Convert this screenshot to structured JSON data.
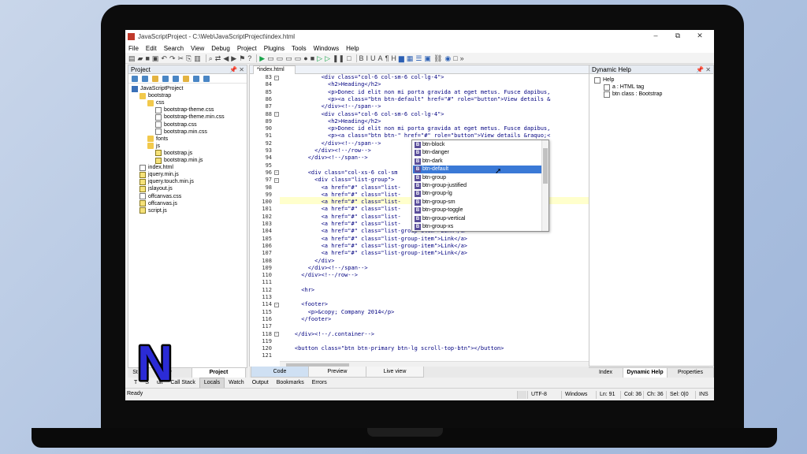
{
  "window": {
    "title": "JavaScriptProject - C:\\Web\\JavaScriptProject\\index.html",
    "controls": [
      "–",
      "⧉",
      "✕"
    ]
  },
  "menu": [
    "File",
    "Edit",
    "Search",
    "View",
    "Debug",
    "Project",
    "Plugins",
    "Tools",
    "Windows",
    "Help"
  ],
  "toolbar": [
    "B",
    "I",
    "U",
    "A",
    "¶",
    "H"
  ],
  "project_panel": {
    "title": "Project",
    "tree": [
      {
        "label": "JavaScriptProject",
        "icon": "project-icon",
        "depth": 0
      },
      {
        "label": "bootstrap",
        "icon": "folder-icon",
        "depth": 1
      },
      {
        "label": "css",
        "icon": "folder-icon",
        "depth": 2
      },
      {
        "label": "bootstrap-theme.css",
        "icon": "file-icon",
        "depth": 3
      },
      {
        "label": "bootstrap-theme.min.css",
        "icon": "file-icon",
        "depth": 3
      },
      {
        "label": "bootstrap.css",
        "icon": "file-icon",
        "depth": 3
      },
      {
        "label": "bootstrap.min.css",
        "icon": "file-icon",
        "depth": 3
      },
      {
        "label": "fonts",
        "icon": "folder-icon",
        "depth": 2
      },
      {
        "label": "js",
        "icon": "folder-icon",
        "depth": 2
      },
      {
        "label": "bootstrap.js",
        "icon": "js-file-icon",
        "depth": 3
      },
      {
        "label": "bootstrap.min.js",
        "icon": "js-file-icon",
        "depth": 3
      },
      {
        "label": "index.html",
        "icon": "file-icon",
        "depth": 1
      },
      {
        "label": "jquery.min.js",
        "icon": "js-file-icon",
        "depth": 1
      },
      {
        "label": "jquery.touch.min.js",
        "icon": "js-file-icon",
        "depth": 1
      },
      {
        "label": "jslayout.js",
        "icon": "js-file-icon",
        "depth": 1
      },
      {
        "label": "offcanvas.css",
        "icon": "file-icon",
        "depth": 1
      },
      {
        "label": "offcanvas.js",
        "icon": "js-file-icon",
        "depth": 1
      },
      {
        "label": "script.js",
        "icon": "js-file-icon",
        "depth": 1
      }
    ],
    "tabs": [
      "St",
      "iew",
      "Project"
    ]
  },
  "editor": {
    "tab_label": "*index.html",
    "lines": [
      {
        "n": "83",
        "code": "            <div class=\"col-6 col-sm-6 col-lg-4\">"
      },
      {
        "n": "84",
        "code": "              <h2>Heading</h2>"
      },
      {
        "n": "85",
        "code": "              <p>Donec id elit non mi porta gravida at eget metus. Fusce dapibus,"
      },
      {
        "n": "86",
        "code": "              <p><a class=\"btn btn-default\" href=\"#\" role=\"button\">View details &"
      },
      {
        "n": "87",
        "code": "            </div><!--/span-->"
      },
      {
        "n": "88",
        "code": "            <div class=\"col-6 col-sm-6 col-lg-4\">"
      },
      {
        "n": "89",
        "code": "              <h2>Heading</h2>"
      },
      {
        "n": "90",
        "code": "              <p>Donec id elit non mi porta gravida at eget metus. Fusce dapibus,"
      },
      {
        "n": "91",
        "code": "              <p><a class=\"btn btn-\" href=\"#\" role=\"button\">View details &raquo;<"
      },
      {
        "n": "92",
        "code": "            </div><!--/span-->"
      },
      {
        "n": "93",
        "code": "          </div><!--/row-->"
      },
      {
        "n": "94",
        "code": "        </div><!--/span-->"
      },
      {
        "n": "95",
        "code": ""
      },
      {
        "n": "96",
        "code": "        <div class=\"col-xs-6 col-sm                                  bar\" ro"
      },
      {
        "n": "97",
        "code": "          <div class=\"list-group\">"
      },
      {
        "n": "98",
        "code": "            <a href=\"#\" class=\"list-"
      },
      {
        "n": "99",
        "code": "            <a href=\"#\" class=\"list-"
      },
      {
        "n": "100",
        "code": "            <a href=\"#\" class=\"list-"
      },
      {
        "n": "101",
        "code": "            <a href=\"#\" class=\"list-"
      },
      {
        "n": "102",
        "code": "            <a href=\"#\" class=\"list-"
      },
      {
        "n": "103",
        "code": "            <a href=\"#\" class=\"list-"
      },
      {
        "n": "104",
        "code": "            <a href=\"#\" class=\"list-group-item\">Link</a>"
      },
      {
        "n": "105",
        "code": "            <a href=\"#\" class=\"list-group-item\">Link</a>"
      },
      {
        "n": "106",
        "code": "            <a href=\"#\" class=\"list-group-item\">Link</a>"
      },
      {
        "n": "107",
        "code": "            <a href=\"#\" class=\"list-group-item\">Link</a>"
      },
      {
        "n": "108",
        "code": "          </div>"
      },
      {
        "n": "109",
        "code": "        </div><!--/span-->"
      },
      {
        "n": "110",
        "code": "      </div><!--/row-->"
      },
      {
        "n": "111",
        "code": ""
      },
      {
        "n": "112",
        "code": "      <hr>"
      },
      {
        "n": "113",
        "code": ""
      },
      {
        "n": "114",
        "code": "      <footer>"
      },
      {
        "n": "115",
        "code": "        <p>&copy; Company 2014</p>"
      },
      {
        "n": "116",
        "code": "      </footer>"
      },
      {
        "n": "117",
        "code": ""
      },
      {
        "n": "118",
        "code": "    </div><!--/.container-->"
      },
      {
        "n": "119",
        "code": ""
      },
      {
        "n": "120",
        "code": "    <button class=\"btn btn-primary btn-lg scroll-top-btn\"></button>"
      },
      {
        "n": "121",
        "code": ""
      }
    ],
    "bottom_tabs": [
      "Code",
      "Preview",
      "Live view"
    ]
  },
  "autocomplete": {
    "badge": "B",
    "items": [
      "btn-block",
      "btn-danger",
      "btn-dark",
      "btn-default",
      "btn-group",
      "btn-group-justified",
      "btn-group-lg",
      "btn-group-sm",
      "btn-group-toggle",
      "btn-group-vertical",
      "btn-group-xs"
    ],
    "selected": "btn-default"
  },
  "help_panel": {
    "title": "Dynamic Help",
    "tree": [
      "Help",
      "a : HTML tag",
      "btn class : Bootstrap"
    ],
    "tabs": [
      "Index",
      "Dynamic Help",
      "Properties"
    ]
  },
  "bottom_tabs": [
    "T",
    "S",
    "ult",
    "Call Stack",
    "Locals",
    "Watch",
    "Output",
    "Bookmarks",
    "Errors"
  ],
  "active_bottom_tab": "Locals",
  "status": {
    "ready": "Ready",
    "encoding": "UTF-8",
    "line_endings": "Windows",
    "ln": "Ln: 91",
    "col": "Col: 36",
    "ch": "Ch: 36",
    "sel": "Sel: 0|0",
    "mode": "INS"
  },
  "logo": {
    "letter": "N",
    "fill": "#2b2bd6",
    "outline": "#000000"
  },
  "colors": {
    "selection": "#3a79d6",
    "current_line": "#ffffcc"
  }
}
